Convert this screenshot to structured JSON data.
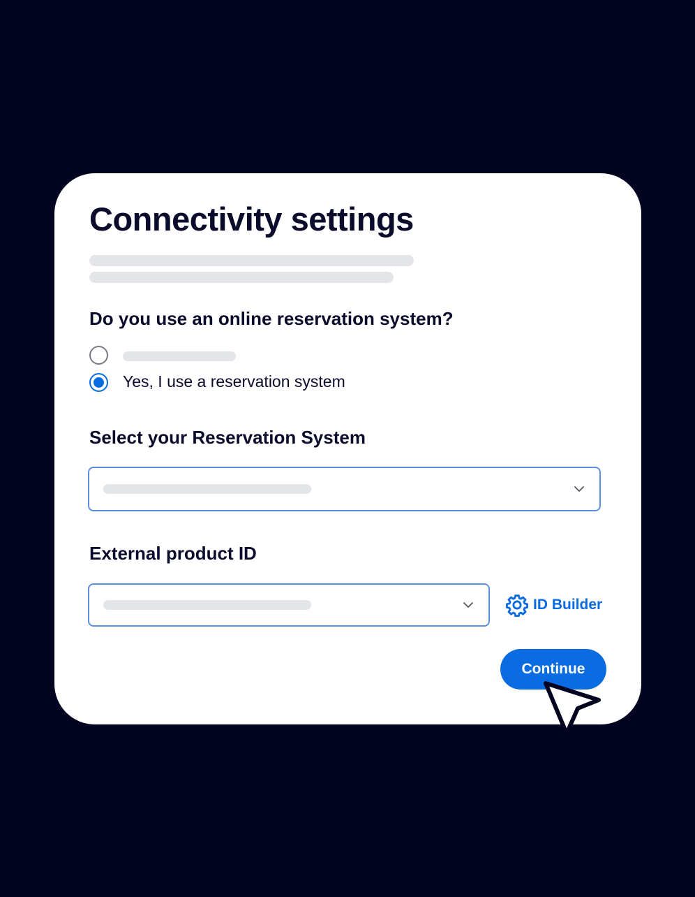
{
  "card": {
    "title": "Connectivity settings"
  },
  "reservation_question": {
    "label": "Do you use an online reservation system?",
    "options": [
      {
        "label": "",
        "selected": false
      },
      {
        "label": "Yes, I use a reservation system",
        "selected": true
      }
    ]
  },
  "reservation_system": {
    "label": "Select your Reservation System",
    "value": ""
  },
  "external_product": {
    "label": "External product ID",
    "value": "",
    "builder_label": "ID Builder"
  },
  "actions": {
    "continue_label": "Continue"
  },
  "colors": {
    "background": "#020420",
    "accent": "#0a6ce0",
    "card": "#ffffff",
    "text": "#0b0b2b",
    "placeholder_skeleton": "#e4e5e8"
  },
  "icons": {
    "dropdown": "chevron-down-icon",
    "builder": "gear-icon",
    "pointer": "mouse-pointer-icon"
  }
}
